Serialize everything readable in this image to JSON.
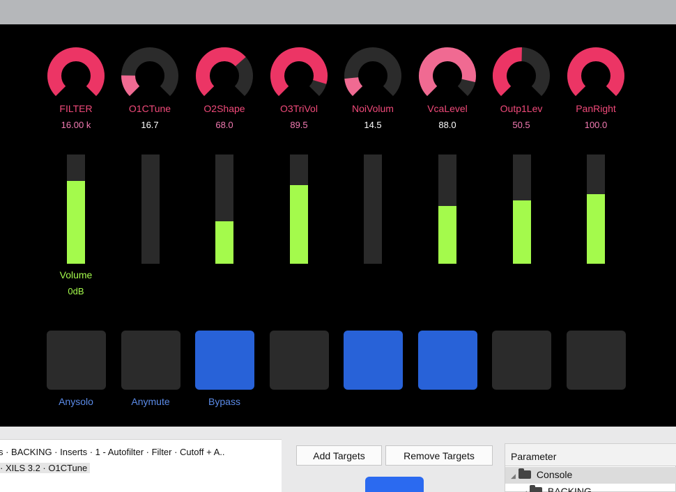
{
  "colors": {
    "knob_active": "#ec3565",
    "knob_pink": "#f06a92",
    "knob_track": "#2b2b2b",
    "fader_fill": "#a4fa4c",
    "pad_on": "#2862d8",
    "pad_off": "#2b2b2b"
  },
  "knobs": [
    {
      "label": "FILTER",
      "value": "16.00 k",
      "fraction": 1.0,
      "color": "#ec3565",
      "value_white": false
    },
    {
      "label": "O1CTune",
      "value": "16.7",
      "fraction": 0.17,
      "color": "#f06a92",
      "value_white": true
    },
    {
      "label": "O2Shape",
      "value": "68.0",
      "fraction": 0.68,
      "color": "#ec3565",
      "value_white": false
    },
    {
      "label": "O3TriVol",
      "value": "89.5",
      "fraction": 0.895,
      "color": "#ec3565",
      "value_white": false
    },
    {
      "label": "NoiVolum",
      "value": "14.5",
      "fraction": 0.145,
      "color": "#f06a92",
      "value_white": true
    },
    {
      "label": "VcaLevel",
      "value": "88.0",
      "fraction": 0.88,
      "color": "#f06a92",
      "value_white": true
    },
    {
      "label": "Outp1Lev",
      "value": "50.5",
      "fraction": 0.505,
      "color": "#ec3565",
      "value_white": false
    },
    {
      "label": "PanRight",
      "value": "100.0",
      "fraction": 1.0,
      "color": "#ec3565",
      "value_white": false
    }
  ],
  "faders": [
    {
      "level": 0.76,
      "label": "Volume",
      "value": "0dB"
    },
    {
      "level": 0.0
    },
    {
      "level": 0.39
    },
    {
      "level": 0.72
    },
    {
      "level": 0.0
    },
    {
      "level": 0.53
    },
    {
      "level": 0.58
    },
    {
      "level": 0.64
    }
  ],
  "pads": [
    {
      "on": false,
      "label": "Anysolo"
    },
    {
      "on": false,
      "label": "Anymute"
    },
    {
      "on": true,
      "label": "Bypass"
    },
    {
      "on": false,
      "label": ""
    },
    {
      "on": true,
      "label": ""
    },
    {
      "on": true,
      "label": ""
    },
    {
      "on": false,
      "label": ""
    },
    {
      "on": false,
      "label": ""
    }
  ],
  "bottom": {
    "left_rows": [
      "s · BACKING · Inserts · 1 - Autofilter · Filter · Cutoff + A..",
      "· XILS 3.2 · O1CTune"
    ],
    "add_targets": "Add Targets",
    "remove_targets": "Remove Targets",
    "parameter_header": "Parameter",
    "tree": [
      {
        "label": "Console",
        "selected": true
      },
      {
        "label": "BACKING",
        "selected": false
      }
    ]
  }
}
